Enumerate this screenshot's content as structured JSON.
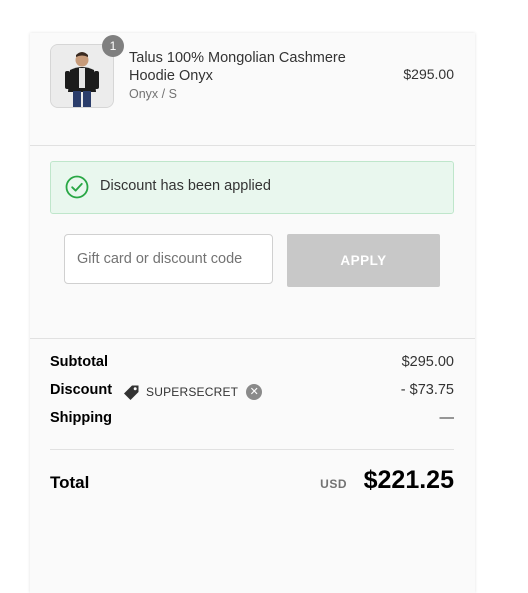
{
  "order_summary": {
    "item": {
      "name": "Talus 100% Mongolian Cashmere Hoodie Onyx",
      "variant": "Onyx / S",
      "price": "$295.00",
      "quantity": "1"
    },
    "notice": {
      "message": "Discount has been applied",
      "icon": "check-circle-icon",
      "color": "#29a745"
    },
    "discount_form": {
      "placeholder": "Gift card or discount code",
      "value": "",
      "apply_label": "APPLY",
      "apply_bg": "#c8c8c8"
    },
    "lines": {
      "subtotal_label": "Subtotal",
      "subtotal_value": "$295.00",
      "discount_label": "Discount",
      "discount_code": "SUPERSECRET",
      "discount_value": "- $73.75",
      "shipping_label": "Shipping",
      "shipping_value": "—"
    },
    "total": {
      "label": "Total",
      "currency": "USD",
      "value": "$221.25"
    }
  }
}
